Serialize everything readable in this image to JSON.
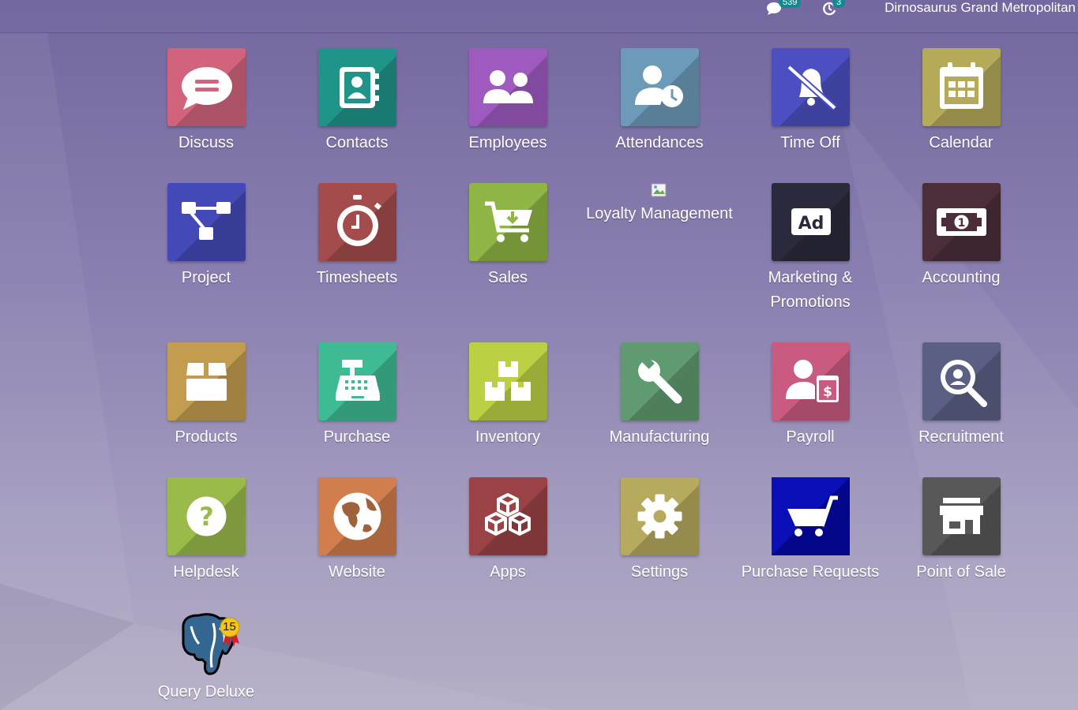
{
  "colors": {
    "bg_top": "#73689f",
    "bg_bottom": "#b4aec6",
    "badge": "#0f8a8e"
  },
  "topbar": {
    "messages_icon": "chat-icon",
    "messages_count": "539",
    "activities_icon": "clock-icon",
    "activities_count": "3",
    "company": "Dirnosaurus Grand Metropolitan"
  },
  "apps": [
    {
      "label": "Discuss",
      "icon": "chat-bubble-icon",
      "color": "#d1647c"
    },
    {
      "label": "Contacts",
      "icon": "address-book-icon",
      "color": "#1f958a"
    },
    {
      "label": "Employees",
      "icon": "people-icon",
      "color": "#9f5ac0"
    },
    {
      "label": "Attendances",
      "icon": "user-clock-icon",
      "color": "#6c9ab9"
    },
    {
      "label": "Time Off",
      "icon": "bell-slash-icon",
      "color": "#4b4fc1"
    },
    {
      "label": "Calendar",
      "icon": "calendar-icon",
      "color": "#b5aa5a"
    },
    {
      "label": "Project",
      "icon": "sitemap-icon",
      "color": "#4449b8"
    },
    {
      "label": "Timesheets",
      "icon": "stopwatch-icon",
      "color": "#a44b4b"
    },
    {
      "label": "Sales",
      "icon": "cart-download-icon",
      "color": "#8fb544"
    },
    {
      "label": "Loyalty Management",
      "icon": "broken-image-icon",
      "color": ""
    },
    {
      "label": "Marketing & Promotions",
      "icon": "ad-icon",
      "color": "#2b2a3c"
    },
    {
      "label": "Accounting",
      "icon": "money-icon",
      "color": "#4b2e3a"
    },
    {
      "label": "Products",
      "icon": "box-icon",
      "color": "#c29d50"
    },
    {
      "label": "Purchase",
      "icon": "cash-register-icon",
      "color": "#3fbb93"
    },
    {
      "label": "Inventory",
      "icon": "boxes-icon",
      "color": "#bdd044"
    },
    {
      "label": "Manufacturing",
      "icon": "wrench-icon",
      "color": "#5f9a70"
    },
    {
      "label": "Payroll",
      "icon": "user-invoice-icon",
      "color": "#c95a80"
    },
    {
      "label": "Recruitment",
      "icon": "search-user-icon",
      "color": "#5b5f84"
    },
    {
      "label": "Helpdesk",
      "icon": "question-icon",
      "color": "#9aba4a"
    },
    {
      "label": "Website",
      "icon": "globe-icon",
      "color": "#d27d4c"
    },
    {
      "label": "Apps",
      "icon": "cubes-icon",
      "color": "#9a4246"
    },
    {
      "label": "Settings",
      "icon": "gear-icon",
      "color": "#b5aa5e"
    },
    {
      "label": "Purchase Requests",
      "icon": "shopping-cart-icon",
      "color": "#0a0fb8"
    },
    {
      "label": "Point of Sale",
      "icon": "store-icon",
      "color": "#585858"
    },
    {
      "label": "Query Deluxe",
      "icon": "postgres-elephant-icon",
      "color": "",
      "badge": "15"
    }
  ]
}
